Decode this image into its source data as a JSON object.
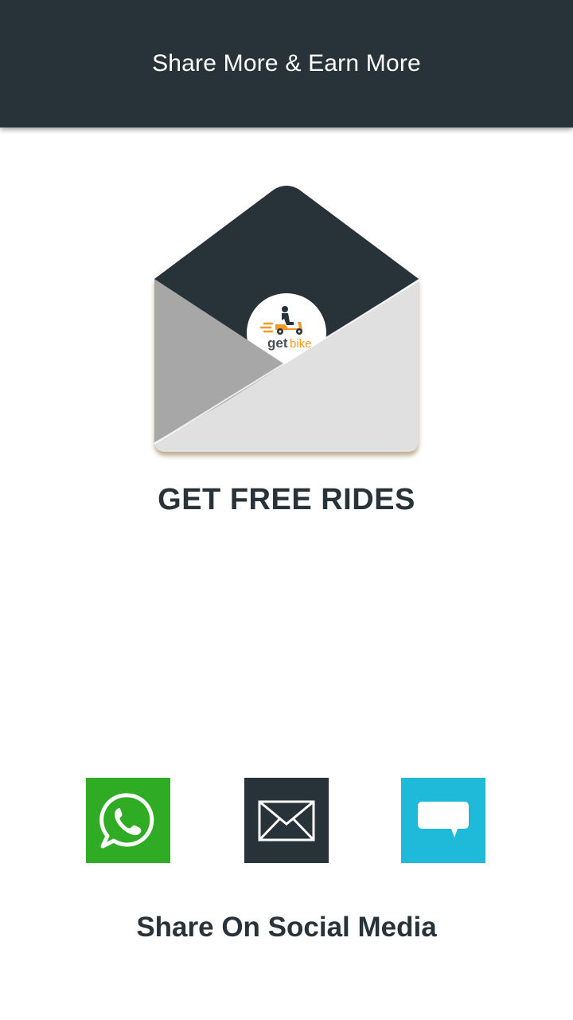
{
  "header": {
    "title": "Share More & Earn More"
  },
  "hero": {
    "icon": "envelope-with-logo",
    "logo_text_get": "get",
    "logo_text_bike": "bike"
  },
  "promo": {
    "title": "GET FREE RIDES"
  },
  "share": {
    "label": "Share On Social Media",
    "options": [
      {
        "name": "whatsapp",
        "icon": "whatsapp-icon",
        "color": "#2fac24"
      },
      {
        "name": "email",
        "icon": "mail-icon",
        "color": "#283239"
      },
      {
        "name": "sms",
        "icon": "chat-bubble-icon",
        "color": "#1fbad9"
      }
    ]
  },
  "colors": {
    "primary_dark": "#283239",
    "accent": "#f39a26",
    "whatsapp_green": "#2fac24",
    "sms_blue": "#1fbad9"
  }
}
